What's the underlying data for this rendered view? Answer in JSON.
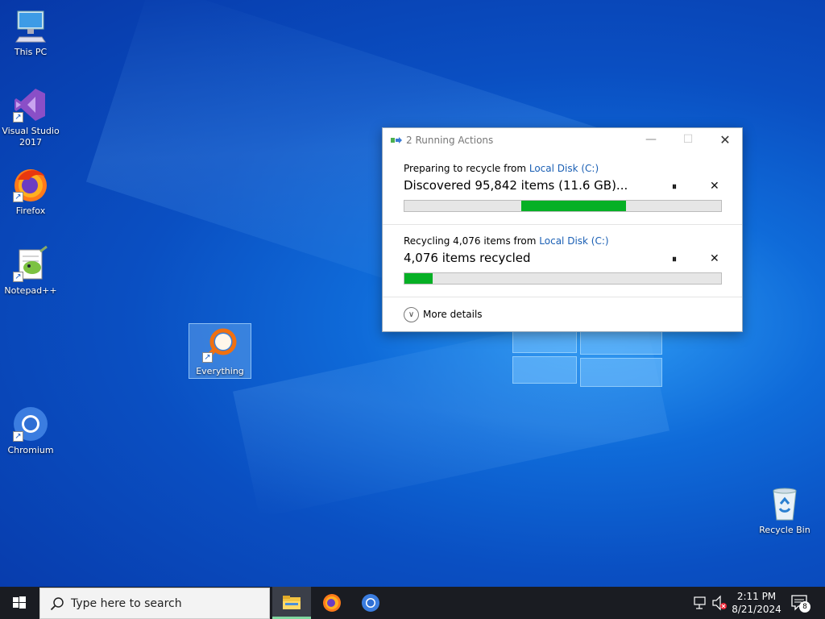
{
  "desktop": {
    "icons": [
      {
        "label": "This PC",
        "icon": "computer-icon"
      },
      {
        "label": "Visual Studio 2017",
        "icon": "visual-studio-icon"
      },
      {
        "label": "Firefox",
        "icon": "firefox-icon"
      },
      {
        "label": "Notepad++",
        "icon": "notepad-plus-plus-icon"
      },
      {
        "label": "Everything",
        "icon": "everything-search-icon"
      },
      {
        "label": "Chromium",
        "icon": "chromium-icon"
      },
      {
        "label": "Recycle Bin",
        "icon": "recycle-bin-icon"
      }
    ]
  },
  "dialog": {
    "title": "2 Running Actions",
    "operations": [
      {
        "prefix": "Preparing to recycle from ",
        "location": "Local Disk (C:)",
        "status": "Discovered 95,842 items (11.6 GB)...",
        "progress_start": 0.37,
        "progress_end": 0.7
      },
      {
        "prefix": "Recycling 4,076 items from ",
        "location": "Local Disk (C:)",
        "status": "4,076 items recycled",
        "progress_start": 0.0,
        "progress_end": 0.09
      }
    ],
    "more_details": "More details",
    "pause_glyph": "⏸",
    "cancel_glyph": "✕"
  },
  "taskbar": {
    "search_placeholder": "Type here to search",
    "apps": [
      "file-explorer-icon",
      "firefox-icon",
      "chromium-icon"
    ],
    "time": "2:11 PM",
    "date": "8/21/2024",
    "notification_count": "8"
  },
  "colors": {
    "progress_fill": "#06b025",
    "link": "#1a5fb4",
    "taskbar": "#1a1c22"
  }
}
